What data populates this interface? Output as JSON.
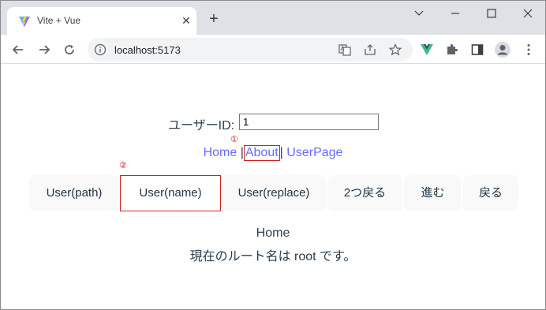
{
  "browser": {
    "tab_title": "Vite + Vue",
    "tab_close_glyph": "✕",
    "new_tab_glyph": "+",
    "address": "localhost:5173",
    "window_controls": [
      "chevron-down-icon",
      "minimize-icon",
      "maximize-icon",
      "close-icon"
    ]
  },
  "page": {
    "user_id_label": "ユーザーID:",
    "user_id_value": "1",
    "links": {
      "home": "Home",
      "separator": "|",
      "about": "About",
      "user_page": "UserPage"
    },
    "markers": {
      "first": "①",
      "second": "②"
    },
    "buttons": [
      "User(path)",
      "User(name)",
      "User(replace)",
      "2つ戻る",
      "進む",
      "戻る"
    ],
    "route_name": "Home",
    "route_message": "現在のルート名は root です。"
  },
  "colors": {
    "link": "#646cff",
    "annotation_red": "#d12020",
    "text": "#2c3e50",
    "tabstrip": "#dee1e6"
  }
}
